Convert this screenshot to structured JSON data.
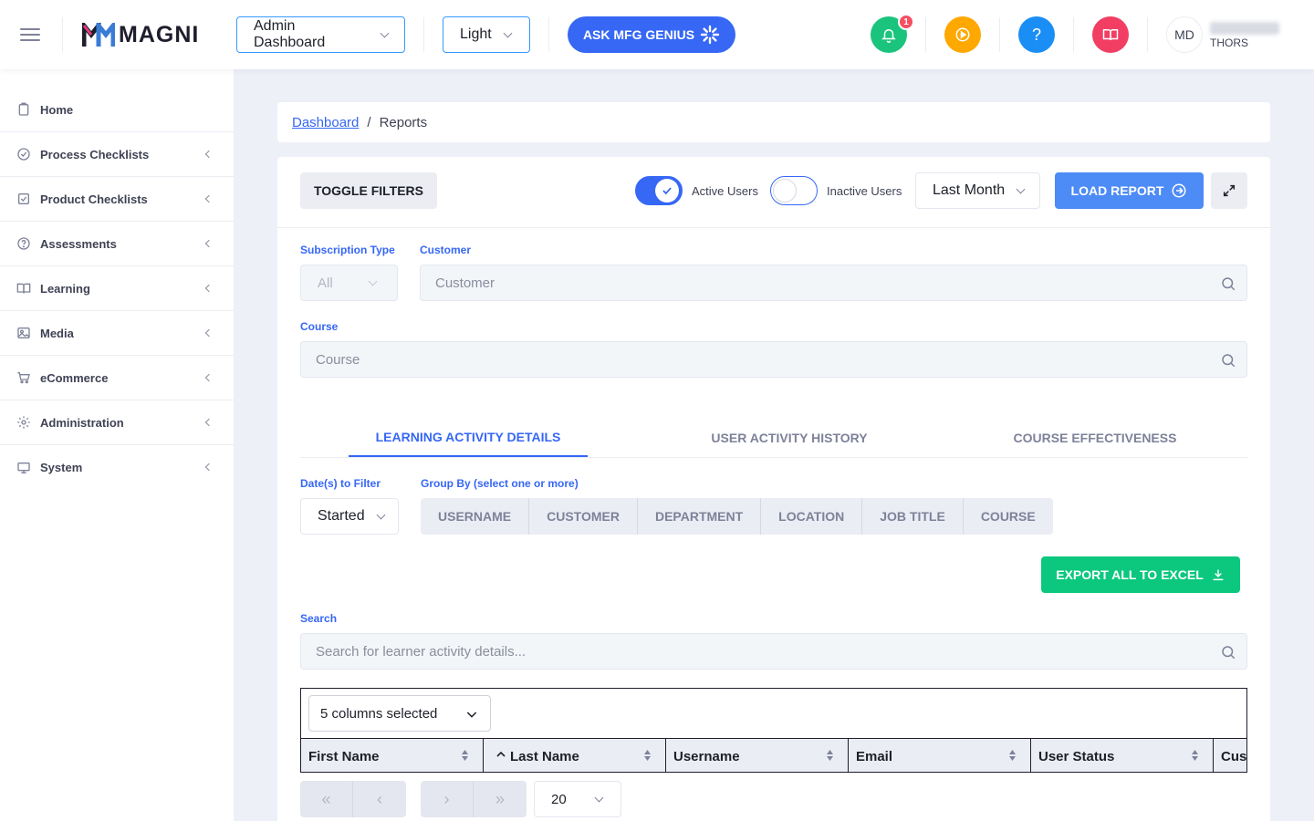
{
  "header": {
    "logo_text": "MAGNI",
    "dashboard_select": "Admin Dashboard",
    "theme_select": "Light",
    "genius_button": "ASK MFG GENIUS",
    "notification_count": "1",
    "avatar_initials": "MD",
    "company": "THORS",
    "colors": {
      "bell": "#1bc47d",
      "play": "#ffa800",
      "help": "#1a8ef5",
      "book": "#f13e62",
      "primary": "#3667f5"
    }
  },
  "sidebar": {
    "items": [
      {
        "label": "Home",
        "icon": "clipboard-icon"
      },
      {
        "label": "Process Checklists",
        "icon": "check-circle-icon"
      },
      {
        "label": "Product Checklists",
        "icon": "check-square-icon"
      },
      {
        "label": "Assessments",
        "icon": "question-circle-icon"
      },
      {
        "label": "Learning",
        "icon": "book-open-icon"
      },
      {
        "label": "Media",
        "icon": "image-icon"
      },
      {
        "label": "eCommerce",
        "icon": "cart-icon"
      },
      {
        "label": "Administration",
        "icon": "gear-icon"
      },
      {
        "label": "System",
        "icon": "monitor-icon"
      }
    ]
  },
  "breadcrumb": {
    "parent": "Dashboard",
    "separator": "/",
    "current": "Reports"
  },
  "toolbar": {
    "toggle_filters": "TOGGLE FILTERS",
    "active_users": "Active Users",
    "inactive_users": "Inactive Users",
    "period": "Last Month",
    "load_report": "LOAD REPORT"
  },
  "filters": {
    "subscription_label": "Subscription Type",
    "subscription_value": "All",
    "customer_label": "Customer",
    "customer_placeholder": "Customer",
    "course_label": "Course",
    "course_placeholder": "Course"
  },
  "tabs": [
    "LEARNING ACTIVITY DETAILS",
    "USER ACTIVITY HISTORY",
    "COURSE EFFECTIVENESS"
  ],
  "details": {
    "dates_label": "Date(s) to Filter",
    "dates_value": "Started",
    "groupby_label": "Group By (select one or more)",
    "groupby": [
      "USERNAME",
      "CUSTOMER",
      "DEPARTMENT",
      "LOCATION",
      "JOB TITLE",
      "COURSE"
    ],
    "export": "EXPORT ALL TO EXCEL",
    "search_label": "Search",
    "search_placeholder": "Search for learner activity details..."
  },
  "table": {
    "columns_selected": "5 columns selected",
    "headers": [
      "First Name",
      "Last Name",
      "Username",
      "Email",
      "User Status",
      "Customer"
    ]
  },
  "pagination": {
    "first": "«",
    "prev": "‹",
    "next": "›",
    "last": "»",
    "page_size": "20"
  }
}
